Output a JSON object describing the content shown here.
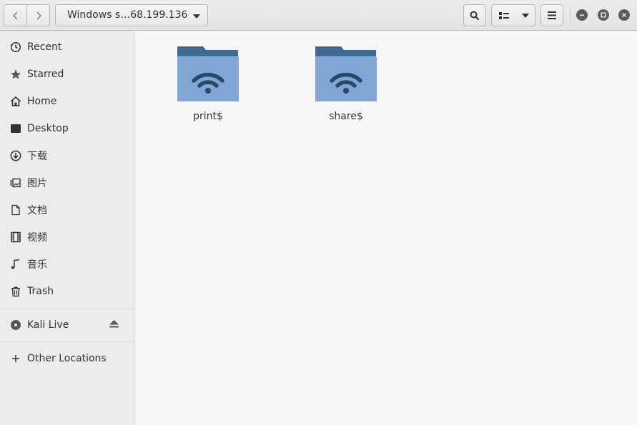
{
  "header": {
    "back_icon": "chevron-left-icon",
    "forward_icon": "chevron-right-icon",
    "path_label": "Windows s…68.199.136",
    "search_icon": "search-icon",
    "view_icon": "list-view-icon",
    "menu_icon": "hamburger-menu-icon",
    "window_controls": [
      "minimize-icon",
      "maximize-icon",
      "close-icon"
    ]
  },
  "sidebar": {
    "places": [
      {
        "label": "Recent",
        "icon": "clock-icon"
      },
      {
        "label": "Starred",
        "icon": "star-icon"
      },
      {
        "label": "Home",
        "icon": "home-icon"
      },
      {
        "label": "Desktop",
        "icon": "desktop-icon"
      },
      {
        "label": "下载",
        "icon": "download-icon"
      },
      {
        "label": "图片",
        "icon": "pictures-icon"
      },
      {
        "label": "文档",
        "icon": "document-icon"
      },
      {
        "label": "视频",
        "icon": "video-icon"
      },
      {
        "label": "音乐",
        "icon": "music-icon"
      },
      {
        "label": "Trash",
        "icon": "trash-icon"
      }
    ],
    "devices": [
      {
        "label": "Kali Live",
        "icon": "disc-icon",
        "action_icon": "eject-icon"
      }
    ],
    "other": {
      "label": "Other Locations",
      "icon": "plus-icon"
    }
  },
  "files": [
    {
      "name": "print$",
      "icon": "network-share-folder-icon"
    },
    {
      "name": "share$",
      "icon": "network-share-folder-icon"
    }
  ],
  "colors": {
    "folder_top": "#3d6b93",
    "folder_body": "#7fa6d6",
    "folder_symbol": "#284a67",
    "sidebar_bg": "#ececec",
    "content_bg": "#f6f6f6"
  }
}
